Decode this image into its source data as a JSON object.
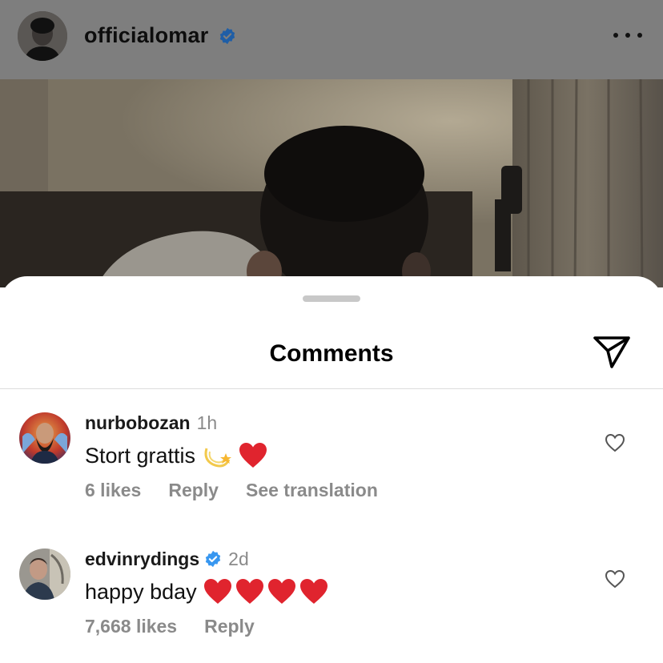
{
  "post": {
    "username": "officialomar",
    "verified": true,
    "icons": {
      "avatar": "profile-photo",
      "more": "more-horizontal-icon",
      "verified": "verified-badge-icon"
    }
  },
  "comments_sheet": {
    "title": "Comments",
    "share_icon": "paper-plane-icon"
  },
  "comments": [
    {
      "username": "nurbobozan",
      "verified": false,
      "time": "1h",
      "text": "Stort grattis",
      "emoji": [
        "dizzy",
        "red-heart"
      ],
      "likes": "6 likes",
      "reply": "Reply",
      "translation": "See translation"
    },
    {
      "username": "edvinrydings",
      "verified": true,
      "time": "2d",
      "text": "happy bday",
      "emoji": [
        "red-heart",
        "red-heart",
        "red-heart",
        "red-heart"
      ],
      "likes": "7,668 likes",
      "reply": "Reply"
    }
  ],
  "colors": {
    "verified_blue": "#3897f0",
    "heart_red": "#e0242e",
    "secondary_text": "#8a8a8a",
    "dim_overlay": "#7e7e7e"
  }
}
